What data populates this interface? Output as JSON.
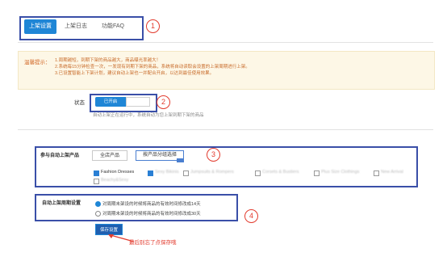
{
  "tabs": [
    {
      "label": "上架设置",
      "active": true
    },
    {
      "label": "上架日志",
      "active": false
    },
    {
      "label": "功能FAQ",
      "active": false
    }
  ],
  "annotations": {
    "n1": "1",
    "n2": "2",
    "n3": "3",
    "n4": "4",
    "save_note": "最后别忘了点保存哦"
  },
  "notice": {
    "title": "温馨提示：",
    "lines": [
      "1.周期越短，到期下架的商品越大，商品曝光率越大！",
      "2.系统每15分钟检查一次，一发现有到期下架的商品，系统将自动读取会设置的上架周期进行上架。",
      "3.已设置智能上下架计划，建议自动上架也一并配合开启，以达到最佳使用效果。"
    ]
  },
  "status": {
    "label": "状态",
    "toggle_on_label": "已开启",
    "hint": "自动上架正在运行中，系统自动为您上架到期下架的商品"
  },
  "products": {
    "label": "参与自动上架产品",
    "all_button": "全店产品",
    "group_button": "按产品分组选择",
    "categories": [
      {
        "label": "Fashion Dresses",
        "checked": true,
        "blurred": false
      },
      {
        "label": "Sexy Bikinis",
        "checked": true,
        "blurred": true
      },
      {
        "label": "Jumpsuits & Rompers",
        "checked": false,
        "blurred": true
      },
      {
        "label": "Corsets & Bustiers",
        "checked": false,
        "blurred": true
      },
      {
        "label": "Plus Size Clothings",
        "checked": false,
        "blurred": true
      },
      {
        "label": "New Arrival",
        "checked": false,
        "blurred": true
      },
      {
        "label": "Beachy&Sexy",
        "checked": false,
        "blurred": true
      }
    ]
  },
  "period": {
    "label": "自动上架周期设置",
    "options": [
      {
        "label": "对周期未架设的时候将商品的有效时间修改成14天",
        "selected": true
      },
      {
        "label": "对周期未架设的时候将商品的有效时间修改成30天",
        "selected": false
      }
    ]
  },
  "save_button": "保存设置",
  "colors": {
    "accent": "#1f86d6",
    "highlight": "#3a4fa8",
    "annotation": "#e23b2e",
    "notice_bg": "#fdf7e6"
  }
}
